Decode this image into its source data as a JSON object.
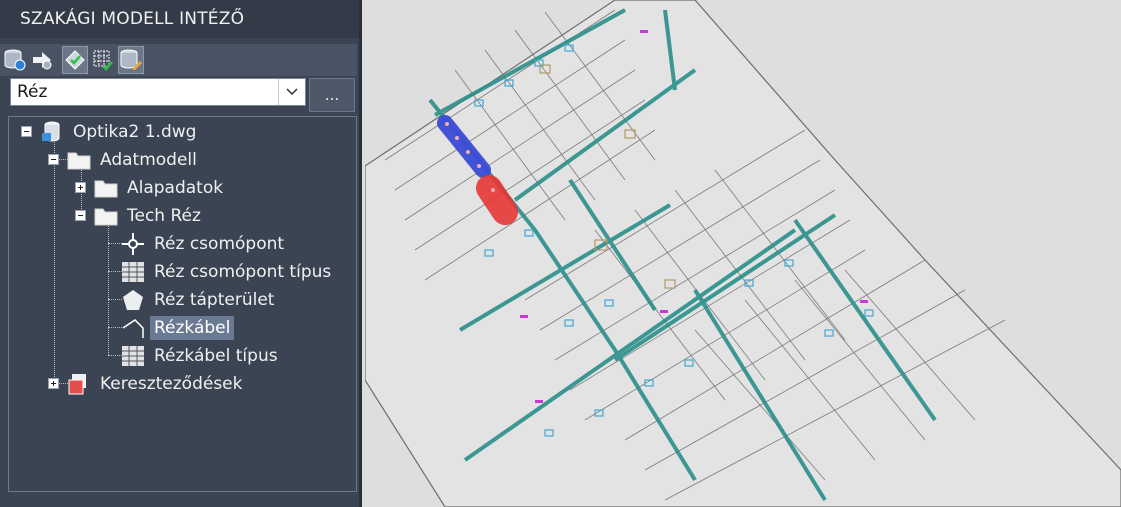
{
  "panel": {
    "title": "SZAKÁGI MODELL INTÉZŐ",
    "toolbar": {
      "buttons": [
        {
          "icon": "database-settings-icon"
        },
        {
          "icon": "arrow-gear-icon"
        },
        {
          "icon": "shield-check-icon"
        },
        {
          "icon": "grid-check-icon"
        },
        {
          "icon": "database-edit-icon"
        }
      ]
    },
    "model_select": {
      "value": "Réz"
    },
    "browse_label": "..."
  },
  "tree": {
    "root": {
      "label": "Optika2 1.dwg",
      "icon": "drawing-database-icon"
    },
    "adatmodell": {
      "label": "Adatmodell",
      "icon": "folder-icon"
    },
    "alapadatok": {
      "label": "Alapadatok",
      "icon": "folder-icon"
    },
    "tech_rez": {
      "label": "Tech Réz",
      "icon": "folder-icon"
    },
    "items": [
      {
        "label": "Réz csomópont",
        "icon": "node-point-icon"
      },
      {
        "label": "Réz csomópont típus",
        "icon": "table-icon"
      },
      {
        "label": "Réz tápterület",
        "icon": "pentagon-icon"
      },
      {
        "label": "Rézkábel",
        "icon": "cable-line-icon",
        "selected": true
      },
      {
        "label": "Rézkábel típus",
        "icon": "table-icon"
      }
    ],
    "keresztezodesek": {
      "label": "Kereszteződések",
      "icon": "crossing-icon"
    }
  },
  "map": {
    "colors": {
      "background": "#dedede",
      "parcel_line": "#6d6d6d",
      "cable_route": "#2a8f8a",
      "highlight_blue": "#3a4bd6",
      "highlight_red": "#e53535",
      "building": "#3fa9d8"
    }
  }
}
